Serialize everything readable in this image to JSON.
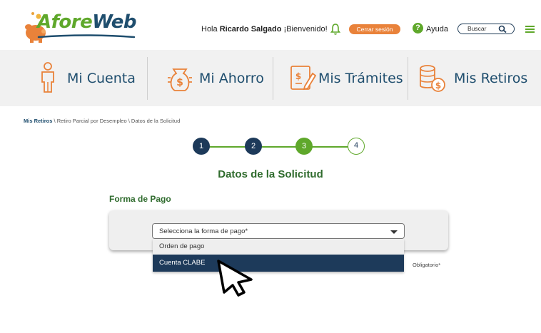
{
  "header": {
    "logo_text_a": "Afore",
    "logo_text_b": "Web",
    "greeting_prefix": "Hola",
    "user_name": "Ricardo Salgado",
    "greeting_suffix": "¡Bienvenido!",
    "logout_label": "Cerrar sesión",
    "help_label": "Ayuda",
    "search_label": "Buscar",
    "icons": [
      "piggy-bank-logo",
      "bell-icon",
      "help-icon",
      "search-icon",
      "menu-icon"
    ]
  },
  "nav": {
    "items": [
      {
        "label": "Mi Cuenta",
        "icon": "user-icon"
      },
      {
        "label": "Mi Ahorro",
        "icon": "money-bag-icon"
      },
      {
        "label": "Mis Trámites",
        "icon": "form-edit-icon"
      },
      {
        "label": "Mis Retiros",
        "icon": "coins-icon"
      }
    ]
  },
  "breadcrumb": {
    "link": "Mis Retiros",
    "path": " \\ Retiro Parcial por Desempleo \\ Datos de la Solicitud"
  },
  "stepper": {
    "steps": [
      "1",
      "2",
      "3",
      "4"
    ],
    "current_step": 3,
    "colors": {
      "done": "#1d3a5a",
      "current": "#5fa82b",
      "pending": "#ffffff"
    }
  },
  "main": {
    "title": "Datos de la Solicitud",
    "subtitle": "Forma de Pago",
    "select": {
      "value": "Selecciona la forma de pago*",
      "options": [
        "Orden de pago",
        "Cuenta CLABE"
      ],
      "highlighted_option": "Cuenta CLABE"
    },
    "required_note": "Obligatorio*"
  },
  "colors": {
    "brand_green": "#5fa82b",
    "brand_navy": "#1d3a5a",
    "logout_orange": "#e9823a"
  }
}
